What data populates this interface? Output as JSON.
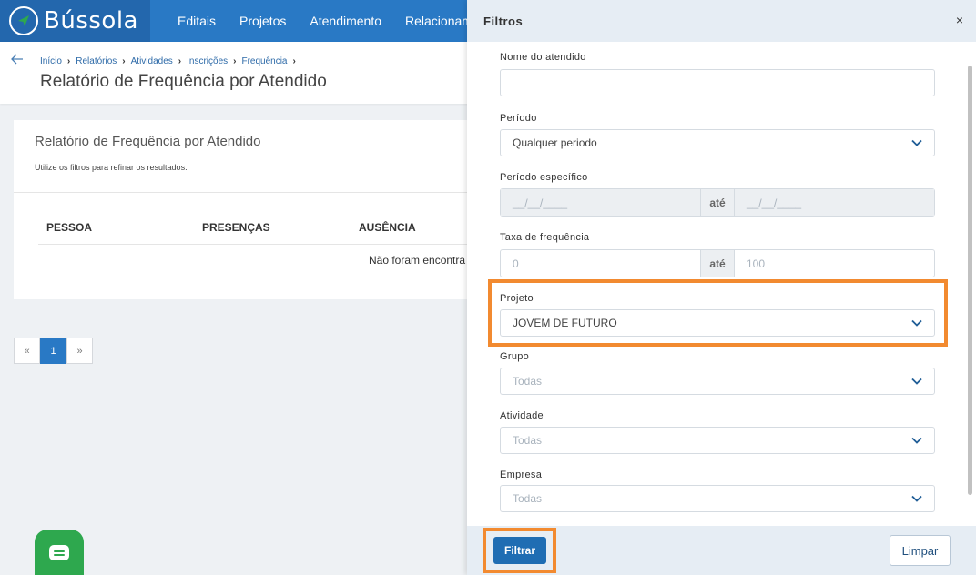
{
  "app": {
    "name": "Bússola"
  },
  "nav": {
    "items": [
      "Editais",
      "Projetos",
      "Atendimento",
      "Relacioname"
    ]
  },
  "breadcrumb": [
    "Início",
    "Relatórios",
    "Atividades",
    "Inscrições",
    "Frequência"
  ],
  "page": {
    "title": "Relatório de Frequência por Atendido"
  },
  "card": {
    "title": "Relatório de Frequência por Atendido",
    "subtitle": "Utilize os filtros para refinar os resultados.",
    "columns": [
      "PESSOA",
      "PRESENÇAS",
      "AUSÊNCIA"
    ],
    "empty_text": "Não foram encontra"
  },
  "pagination": {
    "prev": "«",
    "current": "1",
    "next": "»"
  },
  "filters": {
    "title": "Filtros",
    "close": "×",
    "nome": {
      "label": "Nome do atendido",
      "value": ""
    },
    "periodo": {
      "label": "Período",
      "value": "Qualquer periodo"
    },
    "periodo_especifico": {
      "label": "Período específico",
      "from": "__/__/____",
      "sep": "até",
      "to": "__/__/____"
    },
    "taxa": {
      "label": "Taxa de frequência",
      "from": "0",
      "sep": "até",
      "to": "100"
    },
    "projeto": {
      "label": "Projeto",
      "value": "JOVEM DE FUTURO"
    },
    "grupo": {
      "label": "Grupo",
      "value": "Todas"
    },
    "atividade": {
      "label": "Atividade",
      "value": "Todas"
    },
    "empresa": {
      "label": "Empresa",
      "value": "Todas"
    },
    "filter_button": "Filtrar",
    "clear_button": "Limpar"
  },
  "colors": {
    "brand": "#2979c5",
    "highlight": "#f28a30",
    "chat": "#2ea84e"
  }
}
